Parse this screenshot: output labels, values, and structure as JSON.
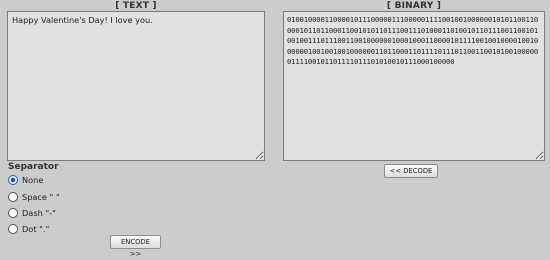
{
  "text_panel": {
    "title": "[ TEXT ]",
    "value": "Happy Valentine's Day! I love you."
  },
  "binary_panel": {
    "title": "[ BINARY ]",
    "value": "0100100001100001011100000111000001111001001000000101011001100001011011000110010101101110011101000110100101101110011001010010011101110011001000000100010001100001011110010010000100100000010010010010000001101100011011110111011001100101001000000111100101101111011101010010111000100000"
  },
  "buttons": {
    "decode_label": "<< DECODE",
    "encode_label": "ENCODE >>"
  },
  "separator": {
    "label": "Separator",
    "options": [
      {
        "label": "None",
        "selected": true
      },
      {
        "label": "Space \" \"",
        "selected": false
      },
      {
        "label": "Dash \"-\"",
        "selected": false
      },
      {
        "label": "Dot \".\"",
        "selected": false
      }
    ]
  },
  "colors": {
    "background": "#cccccc",
    "textarea_background": "#e1e1e1",
    "radio_selected": "#1f4f9a"
  }
}
